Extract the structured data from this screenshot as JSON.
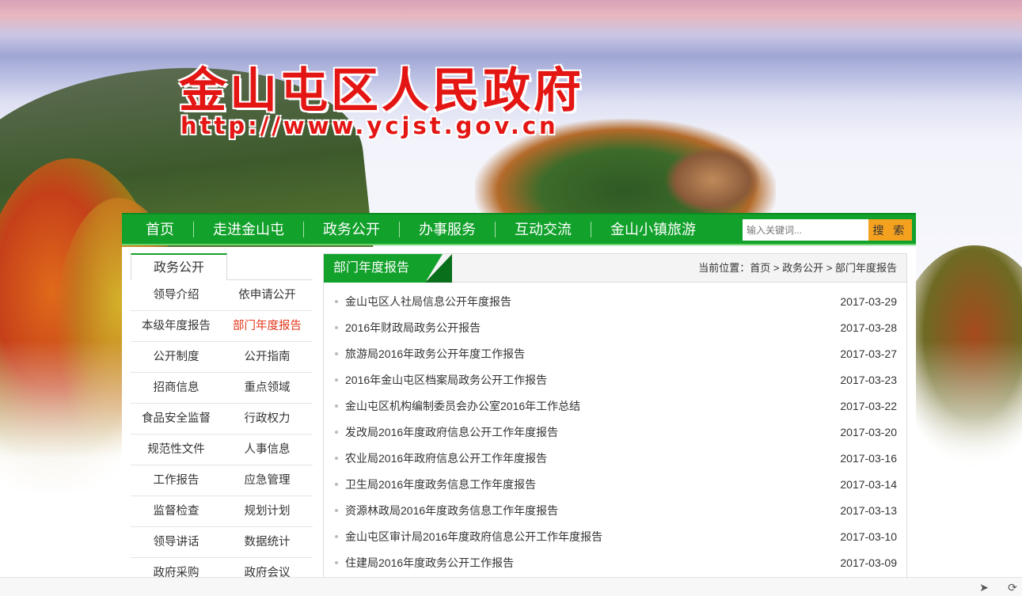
{
  "header": {
    "site_title": "金山屯区人民政府",
    "site_url": "http://www.ycjst.gov.cn"
  },
  "nav": {
    "items": [
      {
        "label": "首页"
      },
      {
        "label": "走进金山屯"
      },
      {
        "label": "政务公开"
      },
      {
        "label": "办事服务"
      },
      {
        "label": "互动交流"
      },
      {
        "label": "金山小镇旅游"
      }
    ],
    "search_placeholder": "输入关键词...",
    "search_button": "搜 索"
  },
  "sidebar": {
    "title": "政务公开",
    "items": [
      {
        "label": "领导介绍",
        "active": false
      },
      {
        "label": "依申请公开",
        "active": false
      },
      {
        "label": "本级年度报告",
        "active": false
      },
      {
        "label": "部门年度报告",
        "active": true
      },
      {
        "label": "公开制度",
        "active": false
      },
      {
        "label": "公开指南",
        "active": false
      },
      {
        "label": "招商信息",
        "active": false
      },
      {
        "label": "重点领域",
        "active": false
      },
      {
        "label": "食品安全监督",
        "active": false
      },
      {
        "label": "行政权力",
        "active": false
      },
      {
        "label": "规范性文件",
        "active": false
      },
      {
        "label": "人事信息",
        "active": false
      },
      {
        "label": "工作报告",
        "active": false
      },
      {
        "label": "应急管理",
        "active": false
      },
      {
        "label": "监督检查",
        "active": false
      },
      {
        "label": "规划计划",
        "active": false
      },
      {
        "label": "领导讲话",
        "active": false
      },
      {
        "label": "数据统计",
        "active": false
      },
      {
        "label": "政府采购",
        "active": false
      },
      {
        "label": "政府会议",
        "active": false
      }
    ]
  },
  "panel": {
    "title": "部门年度报告",
    "breadcrumb": {
      "prefix": "当前位置：",
      "items": [
        "首页",
        "政务公开",
        "部门年度报告"
      ],
      "separator": ">"
    },
    "articles": [
      {
        "title": "金山屯区人社局信息公开年度报告",
        "date": "2017-03-29"
      },
      {
        "title": "2016年财政局政务公开报告",
        "date": "2017-03-28"
      },
      {
        "title": "旅游局2016年政务公开年度工作报告",
        "date": "2017-03-27"
      },
      {
        "title": "2016年金山屯区档案局政务公开工作报告",
        "date": "2017-03-23"
      },
      {
        "title": "金山屯区机构编制委员会办公室2016年工作总结",
        "date": "2017-03-22"
      },
      {
        "title": "发改局2016年度政府信息公开工作年度报告",
        "date": "2017-03-20"
      },
      {
        "title": "农业局2016年政府信息公开工作年度报告",
        "date": "2017-03-16"
      },
      {
        "title": "卫生局2016年度政务信息工作年度报告",
        "date": "2017-03-14"
      },
      {
        "title": "资源林政局2016年度政务信息工作年度报告",
        "date": "2017-03-13"
      },
      {
        "title": "金山屯区审计局2016年度政府信息公开工作年度报告",
        "date": "2017-03-10"
      },
      {
        "title": "住建局2016年度政务公开工作报告",
        "date": "2017-03-09"
      }
    ]
  },
  "colors": {
    "brand_green": "#12a12b",
    "title_red": "#e41614",
    "active_red": "#e4361b",
    "search_orange": "#f4a120"
  },
  "bottom_bar": {
    "icons": [
      "rocket-icon",
      "refresh-icon"
    ]
  }
}
